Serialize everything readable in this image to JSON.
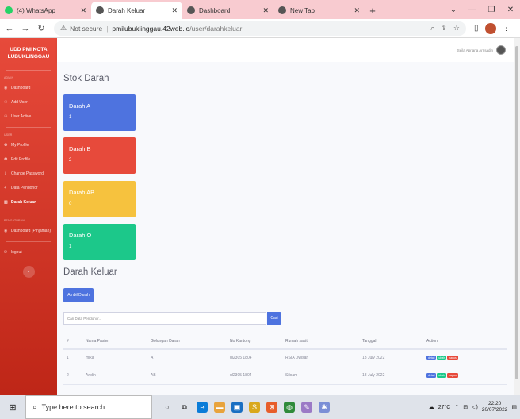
{
  "browser": {
    "tabs": [
      {
        "title": "(4) WhatsApp",
        "fav_color": "#25d366"
      },
      {
        "title": "Darah Keluar",
        "fav_color": "#555555"
      },
      {
        "title": "Dashboard",
        "fav_color": "#555555"
      },
      {
        "title": "New Tab",
        "fav_color": "#555555"
      }
    ],
    "new_tab": "+",
    "security": "Not secure",
    "host": "pmilubuklinggau.42web.io",
    "path": "/user/darahkeluar"
  },
  "sidebar": {
    "brand_line1": "UDD PMI KOTA",
    "brand_line2": "LUBUKLINGGAU",
    "sections": {
      "admin": "ADMIN",
      "user": "USER",
      "pengaturan": "PENGATURAN"
    },
    "items": {
      "dashboard": "Dashboard",
      "add_user": "Add User",
      "user_active": "User Active",
      "my_profile": "My Profile",
      "edit_profile": "Edit Profile",
      "change_password": "Change Password",
      "data_pendonor": "Data Pendonor",
      "darah_keluar": "Darah Keluar",
      "dashboard_pinjaman": "Dashboard (Pinjaman)",
      "logout": "logout"
    }
  },
  "topbar": {
    "user_name": "Seila Apriana Arrisadin"
  },
  "stok": {
    "title": "Stok Darah",
    "cards": [
      {
        "label": "Darah A",
        "value": "1",
        "color": "#4e73df"
      },
      {
        "label": "Darah B",
        "value": "2",
        "color": "#e74a3b"
      },
      {
        "label": "Darah AB",
        "value": "0",
        "color": "#f6c23e"
      },
      {
        "label": "Darah O",
        "value": "1",
        "color": "#1cc88a"
      }
    ]
  },
  "keluar": {
    "title": "Darah Keluar",
    "ambil_button": "Ambil Darah",
    "search_placeholder": "Cari Data Pendonor...",
    "cari_button": "Cari",
    "columns": [
      "#",
      "Nama Pasien",
      "Golongan Darah",
      "No Kantong",
      "Rumah sakit",
      "Tanggal",
      "Action"
    ],
    "rows": [
      {
        "no": "1",
        "nama": "mika",
        "gol": "A",
        "kantong": "ul2305 1804",
        "rs": "RSIA Dwisari",
        "tanggal": "18 July 2022"
      },
      {
        "no": "2",
        "nama": "Andin",
        "gol": "AB",
        "kantong": "ul2305 1804",
        "rs": "Siloam",
        "tanggal": "18 July 2022"
      }
    ],
    "actions": {
      "detail": "detail",
      "ubah": "ubah",
      "hapus": "hapus"
    }
  },
  "taskbar": {
    "search_placeholder": "Type here to search",
    "weather": "27°C",
    "time": "22:20",
    "date": "20/07/2022"
  }
}
